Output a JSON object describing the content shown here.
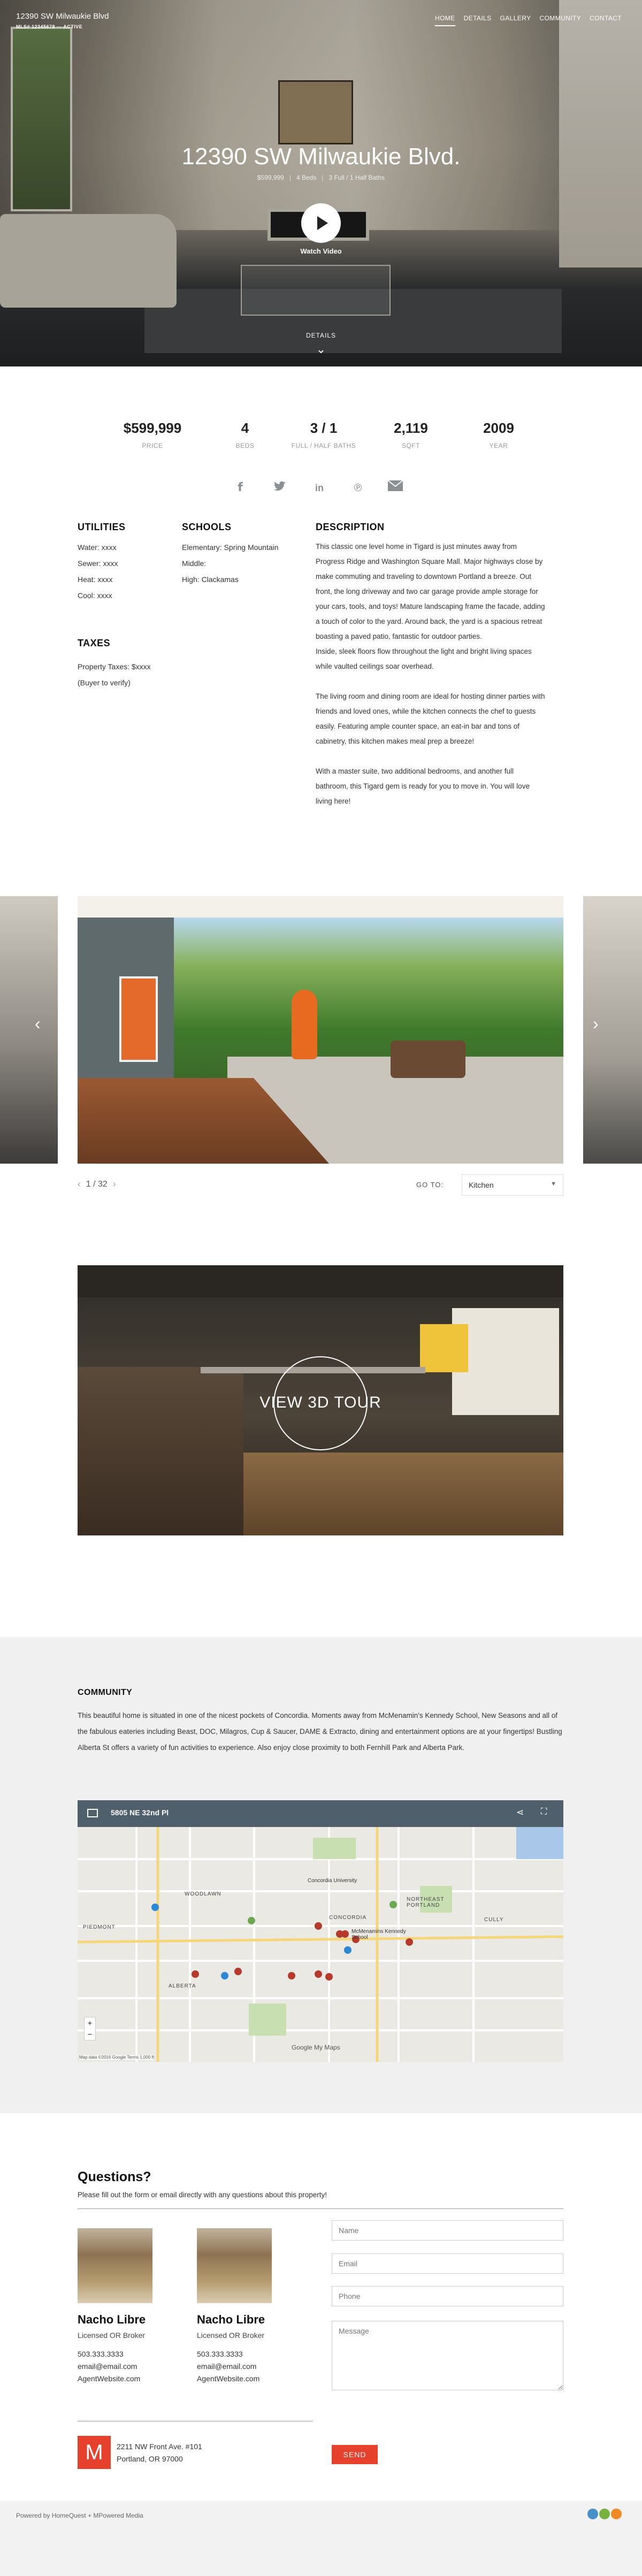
{
  "header": {
    "address": "12390 SW Milwaukie Blvd",
    "status": "MLS# 12345678 — ACTIVE",
    "nav": [
      "HOME",
      "DETAILS",
      "GALLERY",
      "COMMUNITY",
      "CONTACT"
    ]
  },
  "hero": {
    "title": "12390 SW Milwaukie Blvd.",
    "price": "$599,999",
    "beds": "4 Beds",
    "baths": "3 Full / 1 Half Baths",
    "watch_label": "Watch Video",
    "details_label": "DETAILS"
  },
  "stats": [
    {
      "value": "$599,999",
      "label": "PRICE"
    },
    {
      "value": "4",
      "label": "BEDS"
    },
    {
      "value": "3 / 1",
      "label": "FULL / HALF BATHS"
    },
    {
      "value": "2,119",
      "label": "SQFT"
    },
    {
      "value": "2009",
      "label": "YEAR"
    }
  ],
  "share_icons": [
    "facebook-icon",
    "twitter-icon",
    "linkedin-icon",
    "pinterest-icon",
    "email-icon"
  ],
  "utilities": {
    "title": "UTILITIES",
    "items": [
      "Water: xxxx",
      "Sewer: xxxx",
      "Heat: xxxx",
      "Cool: xxxx"
    ]
  },
  "taxes": {
    "title": "TAXES",
    "items": [
      "Property Taxes: $xxxx",
      "(Buyer to verify)"
    ]
  },
  "schools": {
    "title": "SCHOOLS",
    "items": [
      "Elementary: Spring Mountain",
      "Middle:",
      "High: Clackamas"
    ]
  },
  "description": {
    "title": "DESCRIPTION",
    "paragraphs": [
      "This classic one level home in Tigard is just minutes away from Progress Ridge and Washington Square Mall. Major highways close by make commuting and traveling to downtown Portland a breeze. Out front, the long driveway and two car garage provide ample storage for your cars, tools, and toys! Mature landscaping frame the facade, adding a touch of color to the yard. Around back, the yard is a spacious retreat boasting a paved patio, fantastic for outdoor parties.\nInside, sleek floors flow throughout the light and bright living spaces while vaulted ceilings soar overhead.",
      "The living room and dining room are ideal for hosting dinner parties with friends and loved ones, while the kitchen connects the chef to guests easily. Featuring ample counter space, an eat-in bar and tons of cabinetry, this kitchen makes meal prep a breeze!",
      "With a master suite, two additional bedrooms, and another full bathroom, this Tigard gem is ready for you to move in. You will love living here!"
    ]
  },
  "gallery": {
    "counter": "1 / 32",
    "goto_label": "GO TO:",
    "goto_value": "Kitchen"
  },
  "tour": {
    "label": "VIEW 3D TOUR"
  },
  "community": {
    "title": "COMMUNITY",
    "text": "This beautiful home is situated in one of the nicest pockets of Concordia. Moments away from McMenamin's Kennedy School, New Seasons and all of the fabulous eateries including Beast, DOC, Milagros, Cup & Saucer, DAME & Extracto, dining and entertainment options are at your fingertips! Bustling Alberta St offers a variety of fun activities to experience. Also enjoy close proximity to both Fernhill Park and Alberta Park.",
    "map": {
      "title": "5805 NE 32nd Pl",
      "labels": [
        "WOODLAWN",
        "CONCORDIA",
        "NORTHEAST PORTLAND",
        "CULLY",
        "PIEDMONT",
        "ALBERTA",
        "McMenamins Kennedy School",
        "Concordia University"
      ],
      "footer": "Map data ©2016 Google   Terms   1,000 ft",
      "google": "Google My Maps"
    }
  },
  "contact": {
    "title": "Questions?",
    "subtitle": "Please fill out the form or email directly with any questions about this property!",
    "agents": [
      {
        "name": "Nacho Libre",
        "role": "Licensed OR Broker",
        "phone": "503.333.3333",
        "email": "email@email.com",
        "web": "AgentWebsite.com"
      },
      {
        "name": "Nacho Libre",
        "role": "Licensed OR Broker",
        "phone": "503.333.3333",
        "email": "email@email.com",
        "web": "AgentWebsite.com"
      }
    ],
    "office_logo": "M",
    "office_address1": "2211 NW Front Ave. #101",
    "office_address2": "Portland, OR 97000",
    "form": {
      "name_placeholder": "Name",
      "email_placeholder": "Email",
      "phone_placeholder": "Phone",
      "message_placeholder": "Message",
      "send_label": "SEND"
    },
    "accent": "#e5412d"
  },
  "footer": {
    "powered": "Powered by HomeQuest + MPowered Media"
  }
}
